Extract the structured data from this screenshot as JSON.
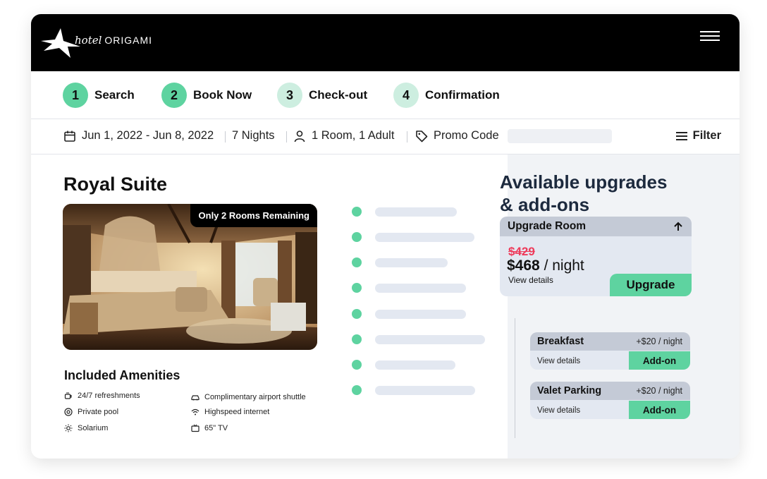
{
  "brand": {
    "script": "hotel",
    "name": "ORIGAMI"
  },
  "steps": [
    {
      "num": "1",
      "label": "Search",
      "state": "done"
    },
    {
      "num": "2",
      "label": "Book Now",
      "state": "done"
    },
    {
      "num": "3",
      "label": "Check-out",
      "state": "todo"
    },
    {
      "num": "4",
      "label": "Confirmation",
      "state": "todo"
    }
  ],
  "filterbar": {
    "dates": "Jun 1, 2022 - Jun 8, 2022",
    "nights": "7 Nights",
    "guests": "1 Room, 1 Adult",
    "promo_label": "Promo Code",
    "filter_label": "Filter"
  },
  "room": {
    "title": "Royal Suite",
    "badge": "Only 2 Rooms Remaining",
    "amenities_title": "Included Amenities",
    "amenities": [
      {
        "icon": "refreshments-icon",
        "label": "24/7 refreshments"
      },
      {
        "icon": "car-icon",
        "label": "Complimentary airport shuttle"
      },
      {
        "icon": "pool-icon",
        "label": "Private pool"
      },
      {
        "icon": "wifi-icon",
        "label": "Highspeed internet"
      },
      {
        "icon": "sun-icon",
        "label": "Solarium"
      },
      {
        "icon": "tv-icon",
        "label": "65\" TV"
      }
    ]
  },
  "upgrades": {
    "title_line1": "Available upgrades",
    "title_line2": "& add-ons",
    "upgrade_card": {
      "title": "Upgrade Room",
      "old_price": "$429",
      "price": "$468",
      "per": "/ night",
      "details": "View details",
      "button": "Upgrade"
    },
    "addons": [
      {
        "name": "Breakfast",
        "price": "+$20 / night",
        "details": "View details",
        "button": "Add-on"
      },
      {
        "name": "Valet Parking",
        "price": "+$20 / night",
        "details": "View details",
        "button": "Add-on"
      }
    ]
  },
  "colors": {
    "accent": "#5ed3a0",
    "accent_light": "#cdeee0",
    "strike": "#ee3a5a",
    "header": "#000000",
    "panel": "#f1f3f6"
  }
}
